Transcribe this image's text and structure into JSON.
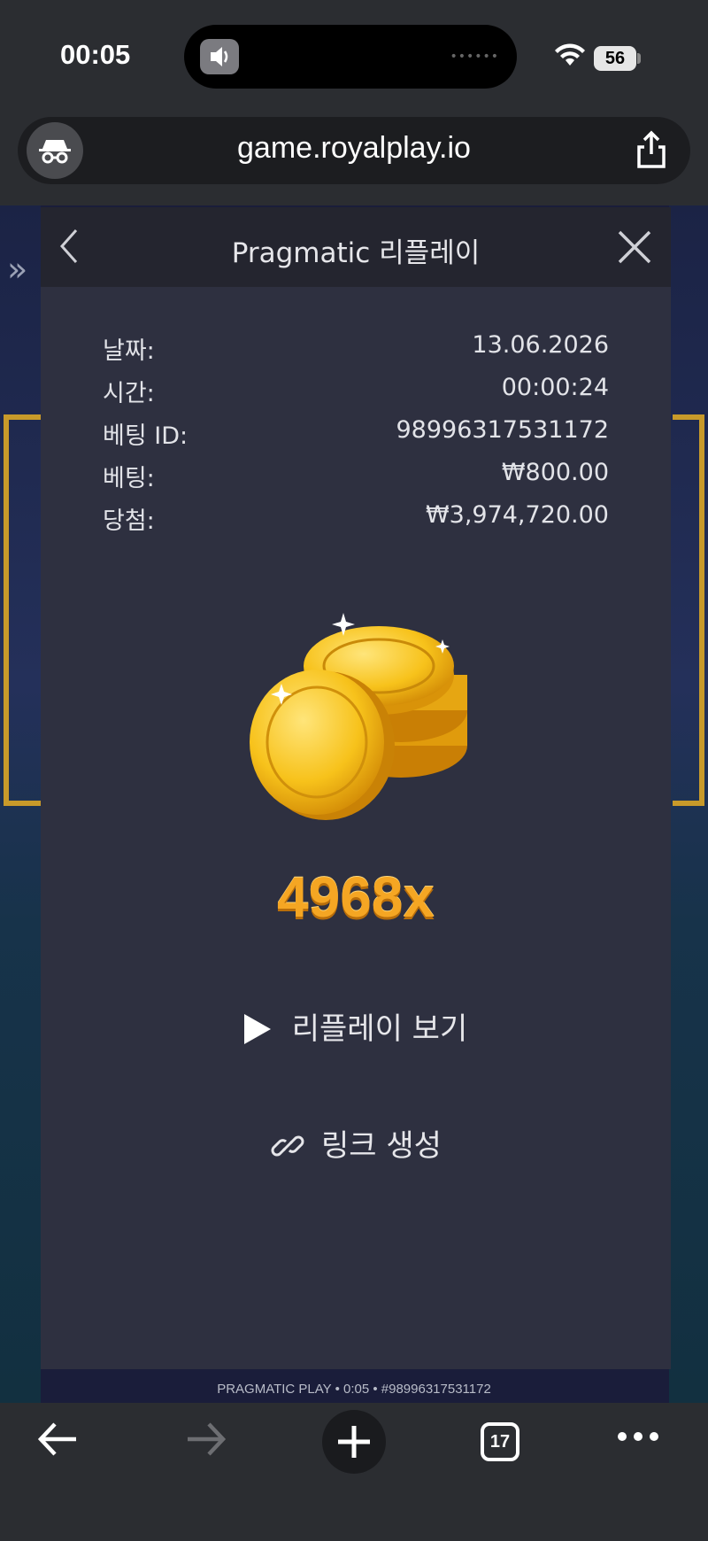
{
  "status_bar": {
    "time": "00:05",
    "battery": "56"
  },
  "browser": {
    "url": "game.royalplay.io",
    "tabs_count": "17"
  },
  "modal": {
    "title": "Pragmatic 리플레이",
    "details": [
      {
        "label": "날짜:",
        "value": "13.06.2026"
      },
      {
        "label": "시간:",
        "value": "00:00:24"
      },
      {
        "label": "베팅 ID:",
        "value": "98996317531172"
      },
      {
        "label": "베팅:",
        "value": "₩800.00"
      },
      {
        "label": "당첨:",
        "value": "₩3,974,720.00"
      }
    ],
    "multiplier": "4968x",
    "replay_label": "리플레이 보기",
    "link_label": "링크 생성"
  },
  "game_footer": "PRAGMATIC PLAY • 0:05 • #98996317531172",
  "colors": {
    "modal_bg": "#2e3040",
    "header_bg": "#24252f",
    "multiplier": "#f5a623"
  },
  "icons": [
    "speaker-icon",
    "wifi-icon",
    "battery-icon",
    "incognito-icon",
    "share-icon",
    "back-chevron-icon",
    "close-icon",
    "coins-icon",
    "play-icon",
    "link-icon",
    "back-arrow-icon",
    "forward-arrow-icon",
    "plus-icon",
    "tabs-icon",
    "more-icon"
  ]
}
